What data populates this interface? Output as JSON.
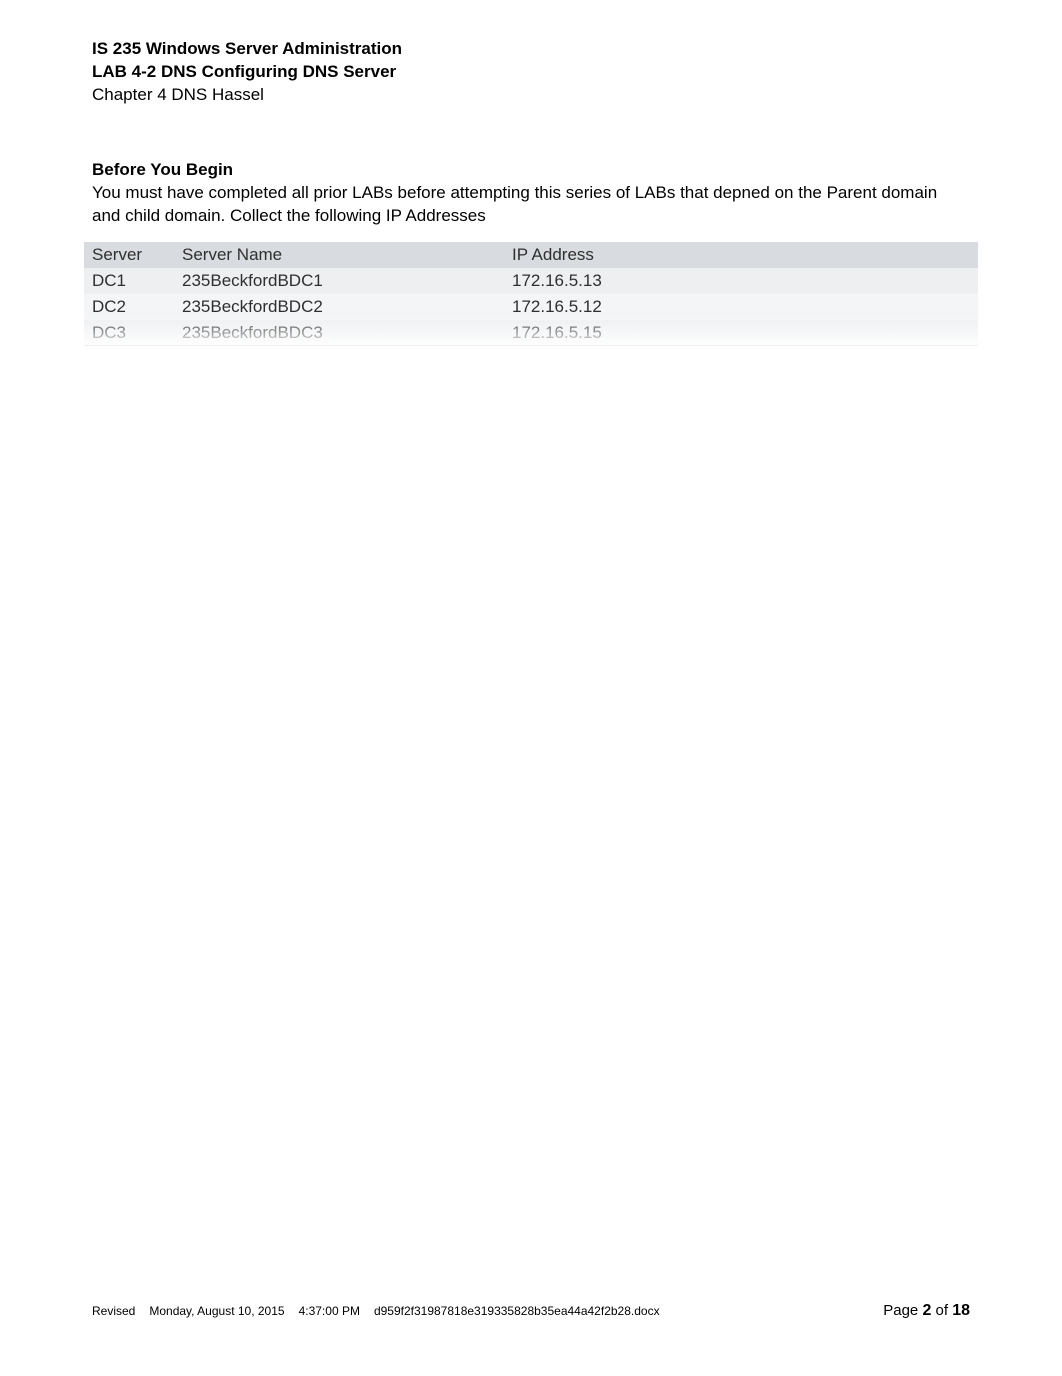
{
  "header": {
    "course": "IS 235 Windows Server Administration",
    "lab": "LAB 4-2 DNS Configuring DNS Server",
    "chapter": "Chapter 4 DNS Hassel"
  },
  "section": {
    "heading": "Before You Begin",
    "body": "You must have completed all prior LABs before attempting this series of LABs that depned on the Parent domain and child domain. Collect the following IP Addresses"
  },
  "table": {
    "columns": {
      "server": "Server",
      "name": "Server Name",
      "ip": "IP Address"
    },
    "rows": [
      {
        "server": "DC1",
        "name": "235BeckfordBDC1",
        "ip": "172.16.5.13"
      },
      {
        "server": "DC2",
        "name": "235BeckfordBDC2",
        "ip": "172.16.5.12"
      },
      {
        "server": "DC3",
        "name": "235BeckfordBDC3",
        "ip": "172.16.5.15"
      }
    ]
  },
  "footer": {
    "revised_label": "Revised",
    "date": "Monday, August 10, 2015",
    "time": "4:37:00 PM",
    "filename": "d959f2f31987818e319335828b35ea44a42f2b28.docx",
    "page_label_prefix": "Page ",
    "page_current": "2",
    "page_of": " of ",
    "page_total": "18"
  }
}
